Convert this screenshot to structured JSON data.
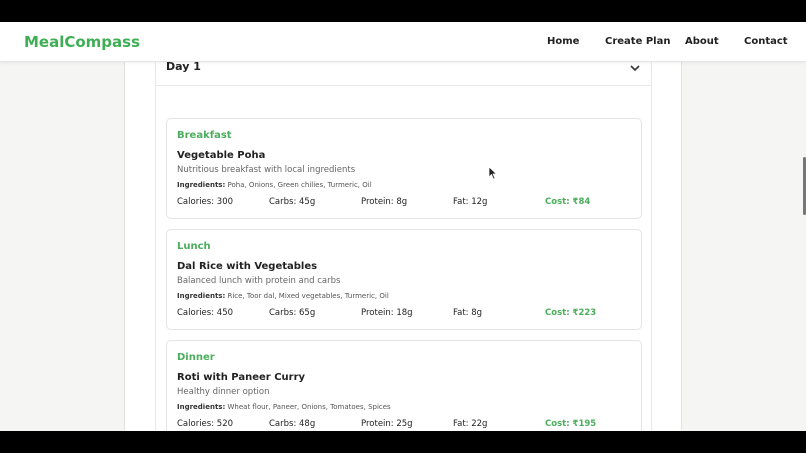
{
  "app": {
    "logo": "MealCompass"
  },
  "nav": [
    {
      "label": "Home"
    },
    {
      "label": "Create Plan"
    },
    {
      "label": "About"
    },
    {
      "label": "Contact"
    }
  ],
  "day": {
    "title": "Day 1",
    "toggle_icon": "chevron-down-icon"
  },
  "meals": [
    {
      "type": "Breakfast",
      "name": "Vegetable Poha",
      "description": "Nutritious breakfast with local ingredients",
      "ingredients_label": "Ingredients:",
      "ingredients": "Poha, Onions, Green chilies, Turmeric, Oil",
      "calories": "Calories: 300",
      "carbs": "Carbs: 45g",
      "protein": "Protein: 8g",
      "fat": "Fat: 12g",
      "cost": "Cost: ₹84"
    },
    {
      "type": "Lunch",
      "name": "Dal Rice with Vegetables",
      "description": "Balanced lunch with protein and carbs",
      "ingredients_label": "Ingredients:",
      "ingredients": "Rice, Toor dal, Mixed vegetables, Turmeric, Oil",
      "calories": "Calories: 450",
      "carbs": "Carbs: 65g",
      "protein": "Protein: 18g",
      "fat": "Fat: 8g",
      "cost": "Cost: ₹223"
    },
    {
      "type": "Dinner",
      "name": "Roti with Paneer Curry",
      "description": "Healthy dinner option",
      "ingredients_label": "Ingredients:",
      "ingredients": "Wheat flour, Paneer, Onions, Tomatoes, Spices",
      "calories": "Calories: 520",
      "carbs": "Carbs: 48g",
      "protein": "Protein: 25g",
      "fat": "Fat: 22g",
      "cost": "Cost: ₹195"
    }
  ],
  "colors": {
    "accent": "#3fae55",
    "text": "#222222",
    "page_bg": "#f5f5f4"
  }
}
